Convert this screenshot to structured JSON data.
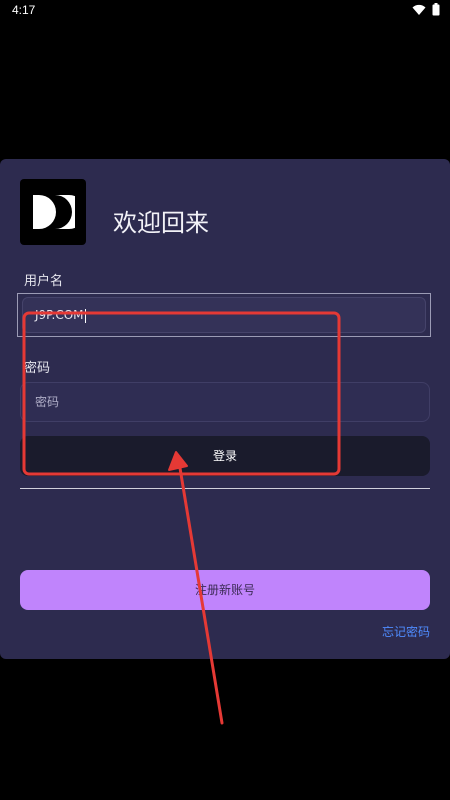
{
  "status_bar": {
    "time": "4:17",
    "icons": [
      "wifi-icon",
      "battery-icon"
    ]
  },
  "login": {
    "welcome": "欢迎回来",
    "username_label": "用户名",
    "username_value": "J9P.COM",
    "password_label": "密码",
    "password_placeholder": "密码",
    "login_button": "登录",
    "register_button": "注册新账号",
    "forgot_password": "忘记密码"
  },
  "colors": {
    "card_background": "#2d2b4f",
    "login_button": "#1a1b2c",
    "register_button": "#c084fc",
    "forgot_link": "#4f8cff",
    "annotation": "#e53935"
  },
  "annotation": {
    "shapes": [
      "highlight-rectangle",
      "arrow"
    ]
  }
}
